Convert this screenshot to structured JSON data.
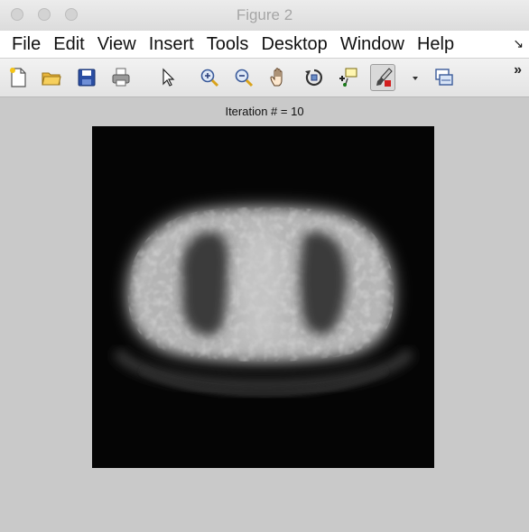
{
  "window": {
    "title": "Figure 2"
  },
  "menubar": {
    "items": [
      "File",
      "Edit",
      "View",
      "Insert",
      "Tools",
      "Desktop",
      "Window",
      "Help"
    ],
    "overflow": "↘"
  },
  "toolbar": {
    "icons": [
      "new-figure-icon",
      "open-file-icon",
      "save-icon",
      "print-icon",
      "pointer-icon",
      "zoom-in-icon",
      "zoom-out-icon",
      "pan-icon",
      "rotate-3d-icon",
      "data-cursor-icon",
      "brush-icon",
      "brush-menu-icon",
      "link-plot-icon"
    ],
    "overflow": "»"
  },
  "figure": {
    "axes_title": "Iteration # = 10"
  }
}
